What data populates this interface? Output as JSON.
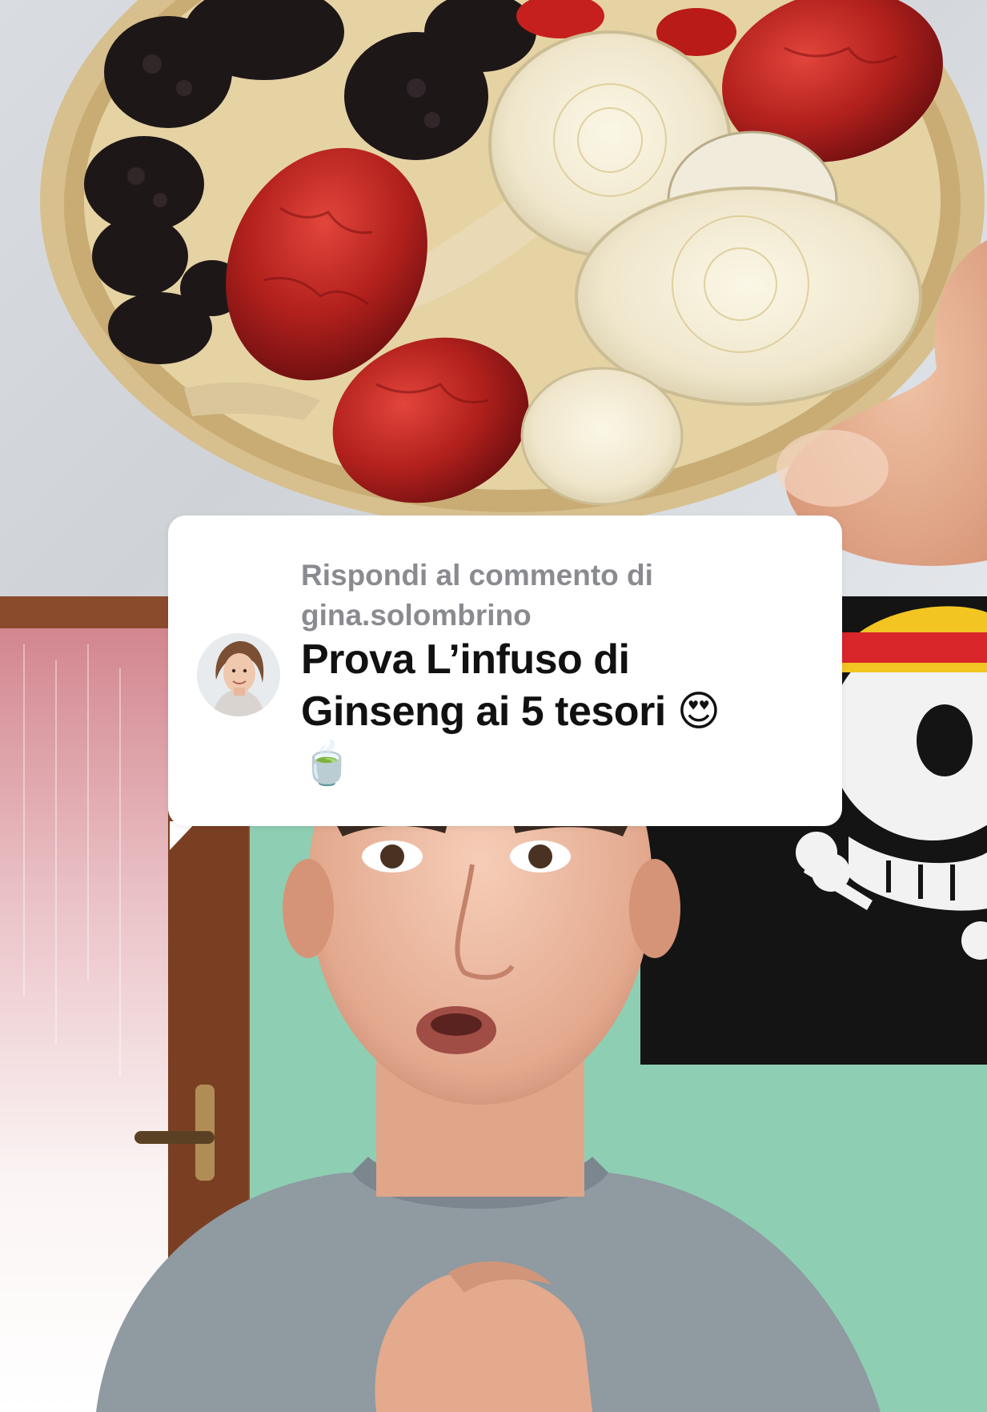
{
  "reply": {
    "header_line1": "Rispondi al commento di",
    "header_line2": "gina.solombrino",
    "comment_line1": "Prova L’infuso di",
    "comment_line2": "Ginseng ai 5 tesori",
    "emoji_heart_eyes": "😍",
    "emoji_tea": "🍵"
  },
  "colors": {
    "bubble_bg": "#ffffff",
    "header_text": "#8a8b91",
    "comment_text": "#111111",
    "wall_green": "#8fcfb4",
    "flag_red": "#d8262b",
    "flag_yellow": "#f2c523"
  },
  "icons": [
    "avatar-photo",
    "straw-hat-jolly-roger-flag",
    "door-handle"
  ]
}
